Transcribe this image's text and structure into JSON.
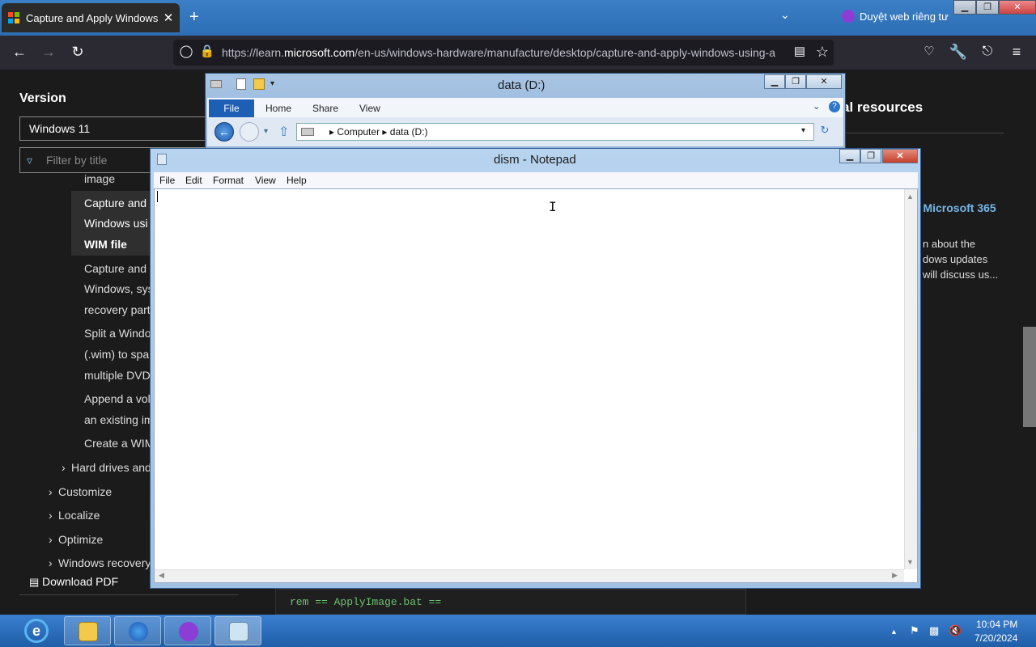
{
  "browser": {
    "tab_title": "Capture and Apply Windows using a",
    "tab_close": "✕",
    "new_tab": "+",
    "private_label": "Duyệt web riêng tư",
    "url_prefix": "https://learn.",
    "url_domain": "microsoft.com",
    "url_rest": "/en-us/windows-hardware/manufacture/desktop/capture-and-apply-windows-using-a",
    "icons": [
      "back-icon",
      "forward-icon",
      "reload-icon",
      "shield-icon",
      "lock-icon",
      "reader-icon",
      "star-icon",
      "pocket-icon",
      "wrench-icon",
      "extensions-icon",
      "menu-icon"
    ]
  },
  "window_controls": {
    "minimize": "▁",
    "maximize": "❐",
    "close": "✕"
  },
  "page": {
    "version_label": "Version",
    "version_value": "Windows 11",
    "filter_placeholder": "Filter by title",
    "toc": {
      "image": "image",
      "active_1": "Capture and",
      "active_2": "Windows usi",
      "active_3": "WIM file",
      "item1_1": "Capture and",
      "item1_2": "Windows, sys",
      "item1_3": "recovery part",
      "item2_1": "Split a Windo",
      "item2_2": "(.wim) to spar",
      "item2_3": "multiple DVD",
      "item3_1": "Append a vol",
      "item3_2": "an existing im",
      "item4": "Create a WIM",
      "hard_drives": "Hard drives and",
      "customize": "Customize",
      "localize": "Localize",
      "optimize": "Optimize",
      "recovery": "Windows recovery"
    },
    "download_pdf": "Download PDF",
    "right_title": "al resources",
    "right_link": "n Microsoft 365",
    "right_line1": "n about the",
    "right_line2": "dows updates",
    "right_line3": "will discuss us...",
    "code": "rem == ApplyImage.bat =="
  },
  "explorer": {
    "title": "data (D:)",
    "tab_file": "File",
    "tab_home": "Home",
    "tab_share": "Share",
    "tab_view": "View",
    "address_computer": "Computer",
    "address_drive": "data (D:)",
    "sep": "▸"
  },
  "notepad": {
    "title": "dism - Notepad",
    "menu_file": "File",
    "menu_edit": "Edit",
    "menu_format": "Format",
    "menu_view": "View",
    "menu_help": "Help",
    "content": ""
  },
  "taskbar": {
    "time": "10:04 PM",
    "date": "7/20/2024",
    "apps": [
      "internet-explorer-icon",
      "file-explorer-icon",
      "firefox-icon",
      "private-browsing-icon",
      "notepad-icon"
    ]
  }
}
